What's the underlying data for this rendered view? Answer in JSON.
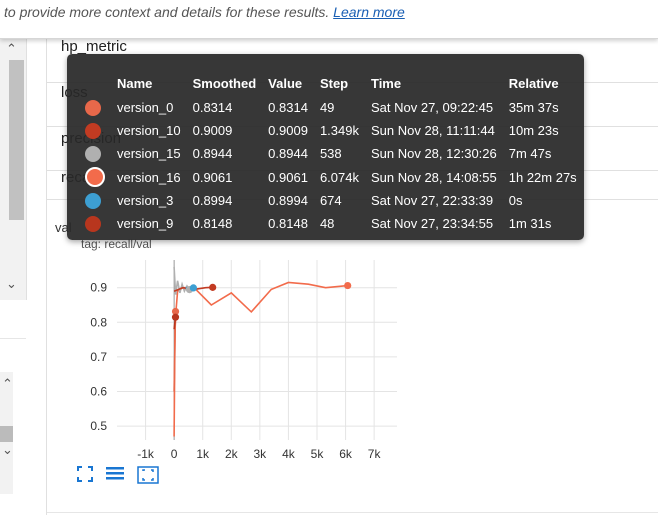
{
  "notice": {
    "text": "to provide more context and details for these results.",
    "link": "Learn more"
  },
  "tags": [
    "hp_metric",
    "loss",
    "precision",
    "recall"
  ],
  "card": {
    "title": "val",
    "tag_label": "tag: recall/val"
  },
  "tooltip": {
    "headers": [
      "Name",
      "Smoothed",
      "Value",
      "Step",
      "Time",
      "Relative"
    ],
    "rows": [
      {
        "name": "version_0",
        "smoothed": "0.8314",
        "value": "0.8314",
        "step": "49",
        "time": "Sat Nov 27, 09:22:45",
        "relative": "35m 37s",
        "color": "#e8684a"
      },
      {
        "name": "version_10",
        "smoothed": "0.9009",
        "value": "0.9009",
        "step": "1.349k",
        "time": "Sun Nov 28, 11:11:44",
        "relative": "10m 23s",
        "color": "#c23b22"
      },
      {
        "name": "version_15",
        "smoothed": "0.8944",
        "value": "0.8944",
        "step": "538",
        "time": "Sun Nov 28, 12:30:26",
        "relative": "7m 47s",
        "color": "#b0b0b0"
      },
      {
        "name": "version_16",
        "smoothed": "0.9061",
        "value": "0.9061",
        "step": "6.074k",
        "time": "Sun Nov 28, 14:08:55",
        "relative": "1h 22m 27s",
        "color": "#f26b4b"
      },
      {
        "name": "version_3",
        "smoothed": "0.8994",
        "value": "0.8994",
        "step": "674",
        "time": "Sat Nov 27, 22:33:39",
        "relative": "0s",
        "color": "#3d9fd2"
      },
      {
        "name": "version_9",
        "smoothed": "0.8148",
        "value": "0.8148",
        "step": "48",
        "time": "Sat Nov 27, 23:34:55",
        "relative": "1m 31s",
        "color": "#b8361e"
      }
    ]
  },
  "chart_data": {
    "type": "line",
    "xlim": [
      -2000,
      7800
    ],
    "ylim": [
      0.46,
      0.98
    ],
    "xticks": [
      -1000,
      0,
      1000,
      2000,
      3000,
      4000,
      5000,
      6000,
      7000
    ],
    "xtick_labels": [
      "-1k",
      "0",
      "1k",
      "2k",
      "3k",
      "4k",
      "5k",
      "6k",
      "7k"
    ],
    "yticks": [
      0.5,
      0.6,
      0.7,
      0.8,
      0.9
    ],
    "ytick_labels": [
      "0.5",
      "0.6",
      "0.7",
      "0.8",
      "0.9"
    ],
    "grid": true,
    "series": [
      {
        "name": "version_16",
        "color": "#f26b4b",
        "x": [
          0,
          30,
          60,
          120,
          300,
          700,
          1300,
          2000,
          2700,
          3400,
          4000,
          4700,
          5300,
          6074
        ],
        "y": [
          0.47,
          0.78,
          0.83,
          0.89,
          0.9,
          0.9,
          0.85,
          0.885,
          0.83,
          0.895,
          0.915,
          0.91,
          0.9,
          0.906
        ]
      },
      {
        "name": "version_15",
        "color": "#b0b0b0",
        "x": [
          0,
          50,
          120,
          200,
          280,
          360,
          450,
          538
        ],
        "y": [
          0.96,
          0.88,
          0.92,
          0.885,
          0.91,
          0.89,
          0.905,
          0.894
        ]
      },
      {
        "name": "version_10",
        "color": "#c23b22",
        "x": [
          0,
          300,
          700,
          1100,
          1349
        ],
        "y": [
          0.89,
          0.9,
          0.895,
          0.9,
          0.901
        ]
      },
      {
        "name": "version_0",
        "color": "#e8684a",
        "x": [
          0,
          49
        ],
        "y": [
          0.6,
          0.831
        ]
      },
      {
        "name": "version_9",
        "color": "#b8361e",
        "x": [
          0,
          48
        ],
        "y": [
          0.78,
          0.815
        ]
      },
      {
        "name": "version_3",
        "color": "#3d9fd2",
        "x": [
          400,
          674
        ],
        "y": [
          0.9,
          0.899
        ]
      }
    ],
    "markers": [
      {
        "name": "version_0",
        "x": 49,
        "y": 0.8314,
        "color": "#e8684a"
      },
      {
        "name": "version_9",
        "x": 48,
        "y": 0.8148,
        "color": "#b8361e"
      },
      {
        "name": "version_15",
        "x": 538,
        "y": 0.8944,
        "color": "#b0b0b0"
      },
      {
        "name": "version_3",
        "x": 674,
        "y": 0.8994,
        "color": "#3d9fd2"
      },
      {
        "name": "version_10",
        "x": 1349,
        "y": 0.9009,
        "color": "#c23b22"
      },
      {
        "name": "version_16",
        "x": 6074,
        "y": 0.9061,
        "color": "#f26b4b"
      }
    ]
  },
  "actions": {
    "fullscreen_icon": "fullscreen-icon",
    "data_icon": "data-table-icon",
    "fit_icon": "fit-domain-icon",
    "accent": "#1976d2"
  }
}
